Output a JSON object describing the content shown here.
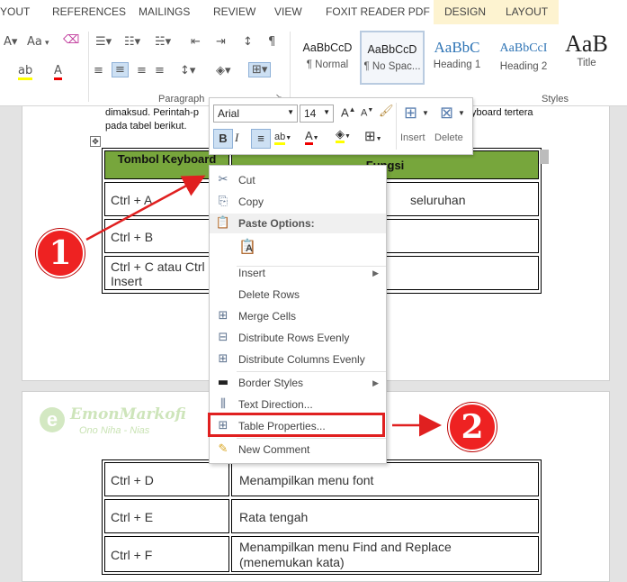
{
  "ribbon_tabs": [
    "YOUT",
    "REFERENCES",
    "MAILINGS",
    "REVIEW",
    "VIEW",
    "FOXIT READER PDF",
    "DESIGN",
    "LAYOUT"
  ],
  "ribbon": {
    "font_size_label": "Aa",
    "paragraph_group_label": "Paragraph",
    "styles_group_label": "Styles",
    "styles": [
      {
        "sample": "AaBbCcD",
        "name": "¶ Normal"
      },
      {
        "sample": "AaBbCcD",
        "name": "¶ No Spac..."
      },
      {
        "sample": "AaBbC",
        "name": "Heading 1"
      },
      {
        "sample": "AaBbCcI",
        "name": "Heading 2"
      },
      {
        "sample": "AaB",
        "name": "Title"
      }
    ]
  },
  "doc": {
    "para_line1_left": "dimaksud. Perintah-p",
    "para_line1_right": "yboard tertera",
    "para_line2": "pada tabel berikut.",
    "table_header": [
      "Tombol Keyboard",
      "Fungsi"
    ],
    "rows_top": [
      {
        "key": "Ctrl + A",
        "func": "seluruhan"
      },
      {
        "key": "Ctrl + B",
        "func": ""
      },
      {
        "key": "Ctrl + C atau Ctrl + Insert",
        "func": ""
      }
    ],
    "rows_bottom": [
      {
        "key": "Ctrl + D",
        "func": "Menampilkan menu font"
      },
      {
        "key": "Ctrl + E",
        "func": "Rata tengah"
      },
      {
        "key": "Ctrl + F",
        "func": "Menampilkan menu Find and Replace (menemukan kata)"
      }
    ],
    "watermark_title": "EmonMarkofi",
    "watermark_sub": "Ono Niha - Nias"
  },
  "mini_toolbar": {
    "font_name": "Arial",
    "font_size": "14",
    "insert_label": "Insert",
    "delete_label": "Delete"
  },
  "context_menu": {
    "items": [
      {
        "label": "Cut",
        "icon": "scissors-icon"
      },
      {
        "label": "Copy",
        "icon": "copy-icon"
      },
      {
        "label": "Paste Options:",
        "icon": "paste-icon"
      },
      {
        "label": "Insert",
        "icon": ""
      },
      {
        "label": "Delete Rows",
        "icon": ""
      },
      {
        "label": "Merge Cells",
        "icon": "merge-cells-icon"
      },
      {
        "label": "Distribute Rows Evenly",
        "icon": "distribute-rows-icon"
      },
      {
        "label": "Distribute Columns Evenly",
        "icon": "distribute-columns-icon"
      },
      {
        "label": "Border Styles",
        "icon": "border-line-icon"
      },
      {
        "label": "Text Direction...",
        "icon": "text-direction-icon"
      },
      {
        "label": "Table Properties...",
        "icon": "table-properties-icon"
      },
      {
        "label": "New Comment",
        "icon": "new-comment-icon"
      }
    ]
  },
  "annotations": {
    "step1": "1",
    "step2": "2",
    "accent_color": "#e02020",
    "table_header_color": "#77a63c"
  }
}
